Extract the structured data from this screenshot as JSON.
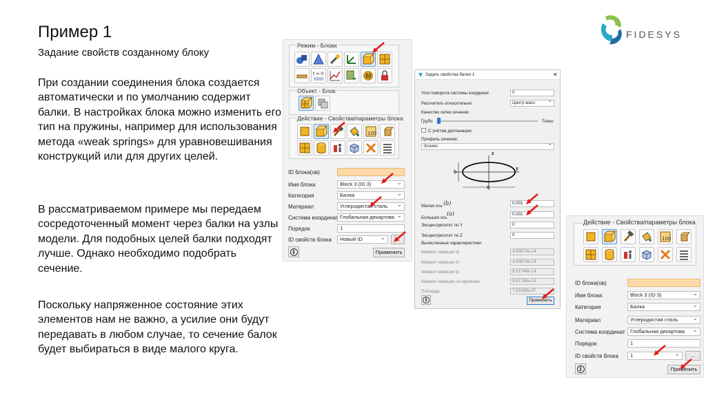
{
  "slide": {
    "title": "Пример 1",
    "subtitle": "Задание свойств созданному блоку",
    "para1": "При создании соединения блока создается автоматически и по умолчанию содержит балки. В настройках блока можно изменить его тип на пружины, например для использования метода «weak springs» для уравновешивания конструкций или для других целей.",
    "para2": "В рассматриваемом примере мы передаем сосредоточенный момент через балки на узлы модели. Для подобных целей балки подходят лучше. Однако необходимо подобрать сечение.",
    "para3": "Поскольку напряженное состояние этих элементов нам не важно, а усилие они будут передавать в любом случае, то сечение балок будет выбираться в виде малого круга."
  },
  "logo": {
    "text": "FIDESYS"
  },
  "left_panel": {
    "mode_group": "Режим - Блоки",
    "object_group": "Объект - Блок",
    "action_group": "Действие - Свойства/параметры блока",
    "fields": [
      {
        "label": "ID блока(ов)",
        "value": ""
      },
      {
        "label": "Имя блока",
        "value": "Block 3 (ID 3)"
      },
      {
        "label": "Категория",
        "value": "Балка"
      },
      {
        "label": "Материал",
        "value": "Углеродистая сталь"
      },
      {
        "label": "Система координат",
        "value": "Глобальная декартова"
      },
      {
        "label": "Порядок",
        "value": "1"
      },
      {
        "label": "ID свойств блока",
        "value": "Новый ID"
      }
    ],
    "more_button": "...",
    "apply_button": "Применить",
    "t0_label": "t = 0"
  },
  "dialog": {
    "title": "Задать свойства балки 1",
    "close": "✕",
    "rotation_label": "Угол поворота системы координат",
    "rotation_value": "0",
    "relative_label": "Рассчитать относительно",
    "relative_value": "Центр масс",
    "mesh_quality_label": "Качество сетки сечения:",
    "coarse": "Грубо",
    "fine": "Точно",
    "planar_label": "С учётом депланации",
    "profile_label": "Профиль сечения:",
    "profile_value": "Эллипс",
    "axis_z": "z",
    "axis_y": "y",
    "dim_a": "a",
    "dim_b": "b",
    "minor_axis_label": "Малая ось",
    "minor_axis_sym": "(b)",
    "minor_axis_value": "0.001",
    "major_axis_label": "Большая ось",
    "major_axis_sym": "(a)",
    "major_axis_value": "0.001",
    "ecc_y_label": "Эксцентриситет по Y",
    "ecc_y_value": "0",
    "ecc_z_label": "Эксцентриситет по Z",
    "ecc_z_value": "0",
    "computed_label": "Вычисленные характеристики:",
    "computed": [
      {
        "label": "Момент инерции Iy",
        "value": "4.90874e-14"
      },
      {
        "label": "Момент инерции Iz",
        "value": "4.90874e-14"
      },
      {
        "label": "Момент инерции Ip",
        "value": "9.81748e-14"
      },
      {
        "label": "Момент инерции на кручение",
        "value": "9.81748e-14"
      },
      {
        "label": "Площадь",
        "value": "7.85398e-07"
      }
    ],
    "apply_button": "Применить"
  },
  "right_panel": {
    "action_group": "Действие - Свойства/параметры блока",
    "fields": [
      {
        "label": "ID блока(ов)",
        "value": ""
      },
      {
        "label": "Имя блока",
        "value": "Block 3 (ID 3)"
      },
      {
        "label": "Категория",
        "value": "Балка"
      },
      {
        "label": "Материал",
        "value": "Углеродистая сталь"
      },
      {
        "label": "Система координат",
        "value": "Глобальная декартова"
      },
      {
        "label": "Порядок",
        "value": "1"
      },
      {
        "label": "ID свойств блока",
        "value": "1"
      }
    ],
    "more_button": "...",
    "apply_button": "Применить"
  },
  "colors": {
    "arrow": "#e31b1b",
    "highlight_field": "#fcd9a6",
    "selected_icon": "#d9ebfb"
  }
}
